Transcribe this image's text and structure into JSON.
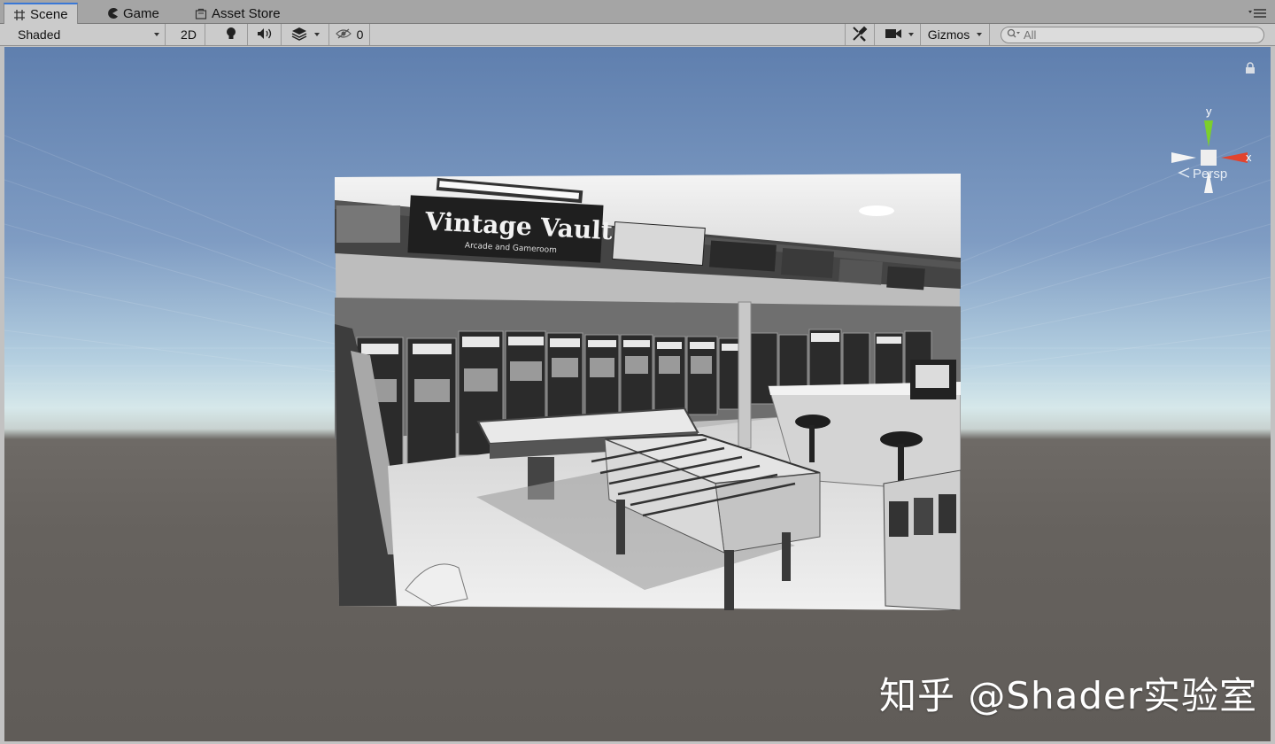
{
  "tabs": [
    {
      "label": "Scene",
      "icon": "grid-icon",
      "active": true
    },
    {
      "label": "Game",
      "icon": "pacman-icon",
      "active": false
    },
    {
      "label": "Asset Store",
      "icon": "shopping-bag-icon",
      "active": false
    }
  ],
  "toolbar": {
    "draw_mode": "Shaded",
    "mode_2d": "2D",
    "lighting_icon": "lightbulb-icon",
    "audio_icon": "speaker-icon",
    "effects_icon": "layers-icon",
    "hidden_count": "0",
    "tools_icon": "wrench-icon",
    "camera_icon": "camera-icon",
    "gizmos_label": "Gizmos",
    "search_placeholder": "All"
  },
  "scene": {
    "photo_sign": "Vintage Vault",
    "photo_subsign": "Arcade and Gameroom",
    "photo_style": "grayscale"
  },
  "gizmo": {
    "y_label": "y",
    "x_label": "x",
    "projection": "Persp",
    "y_color": "#7ccf2c",
    "x_color": "#e2432d"
  },
  "watermark": "知乎 @Shader实验室",
  "colors": {
    "active_tab_accent": "#3a78d6",
    "sky_top": "#5f7fae",
    "horizon": "#d6e8ea",
    "ground": "#66625e"
  }
}
